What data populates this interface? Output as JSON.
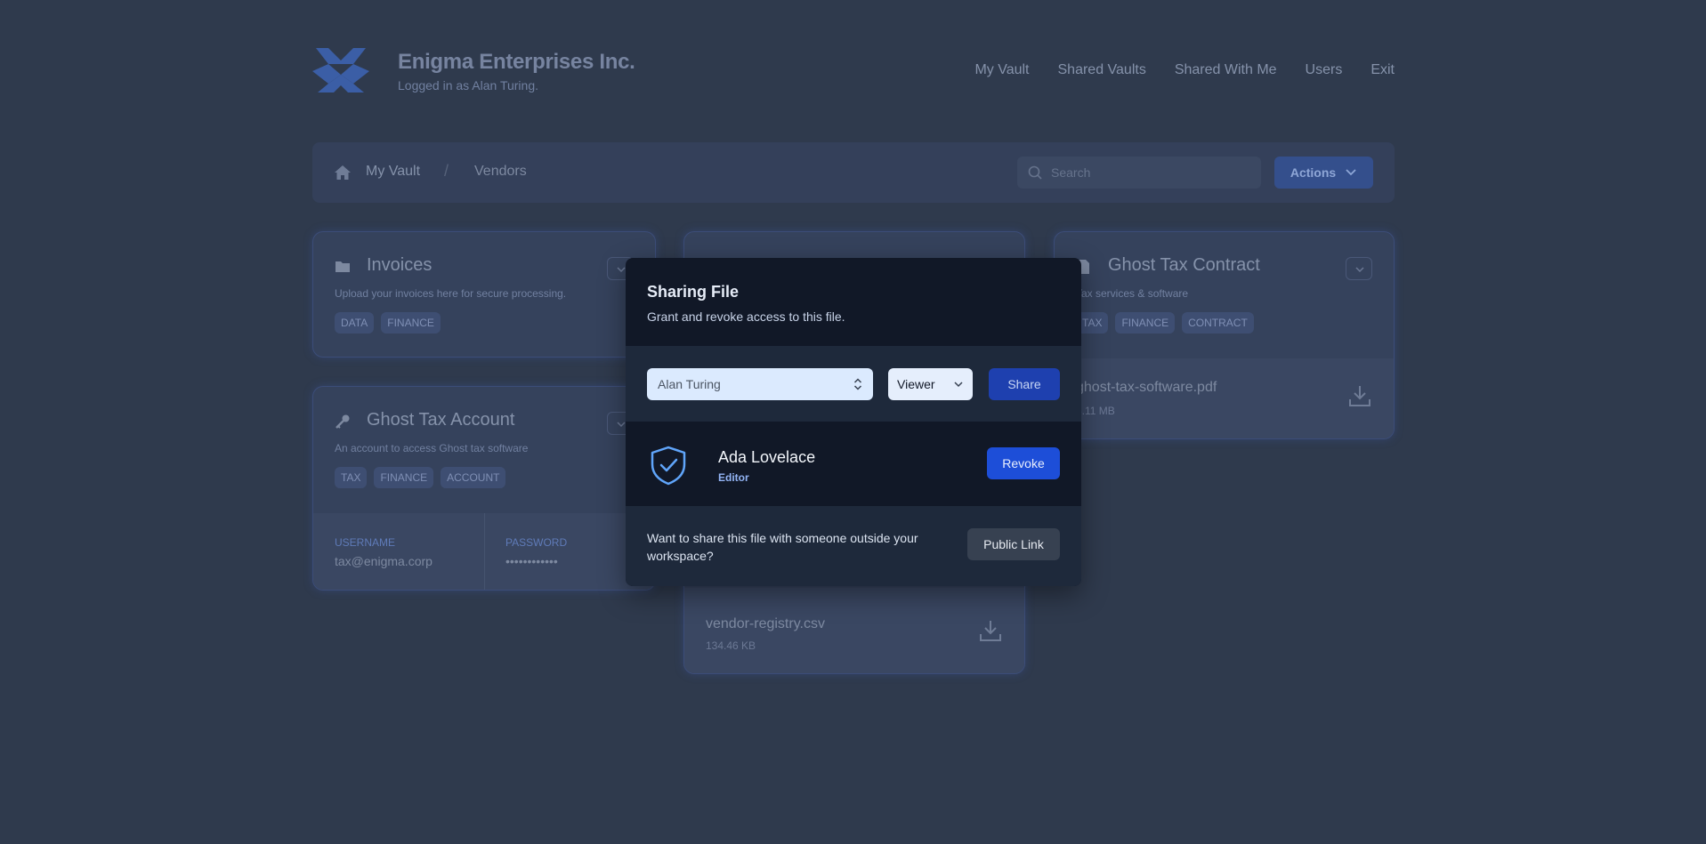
{
  "header": {
    "title": "Enigma Enterprises Inc.",
    "subtitle": "Logged in as Alan Turing.",
    "nav": [
      "My Vault",
      "Shared Vaults",
      "Shared With Me",
      "Users",
      "Exit"
    ]
  },
  "toolbar": {
    "breadcrumb": [
      "My Vault",
      "Vendors"
    ],
    "separator": "/",
    "search_placeholder": "Search",
    "actions_label": "Actions"
  },
  "cards": {
    "invoices": {
      "title": "Invoices",
      "description": "Upload your invoices here for secure processing.",
      "tags": [
        "DATA",
        "FINANCE"
      ]
    },
    "account": {
      "title": "Ghost Tax Account",
      "description": "An account to access Ghost tax software",
      "tags": [
        "TAX",
        "FINANCE",
        "ACCOUNT"
      ],
      "username_label": "USERNAME",
      "username": "tax@enigma.corp",
      "password_label": "PASSWORD",
      "password": "••••••••••••"
    },
    "vendor_file": {
      "name": "vendor-registry.csv",
      "size": "134.46 KB"
    },
    "contract": {
      "title": "Ghost Tax Contract",
      "description": "Tax services & software",
      "tags": [
        "TAX",
        "FINANCE",
        "CONTRACT"
      ],
      "file_name": "ghost-tax-software.pdf",
      "file_size": "3.11 MB"
    }
  },
  "modal": {
    "title": "Sharing File",
    "subtitle": "Grant and revoke access to this file.",
    "user_select": "Alan Turing",
    "role_select": "Viewer",
    "share_label": "Share",
    "member": {
      "name": "Ada Lovelace",
      "role": "Editor"
    },
    "revoke_label": "Revoke",
    "public_text": "Want to share this file with someone outside your workspace?",
    "public_label": "Public Link"
  },
  "colors": {
    "background": "#2f3a4d",
    "modal": "#111827",
    "accent": "#1d4ed8"
  }
}
